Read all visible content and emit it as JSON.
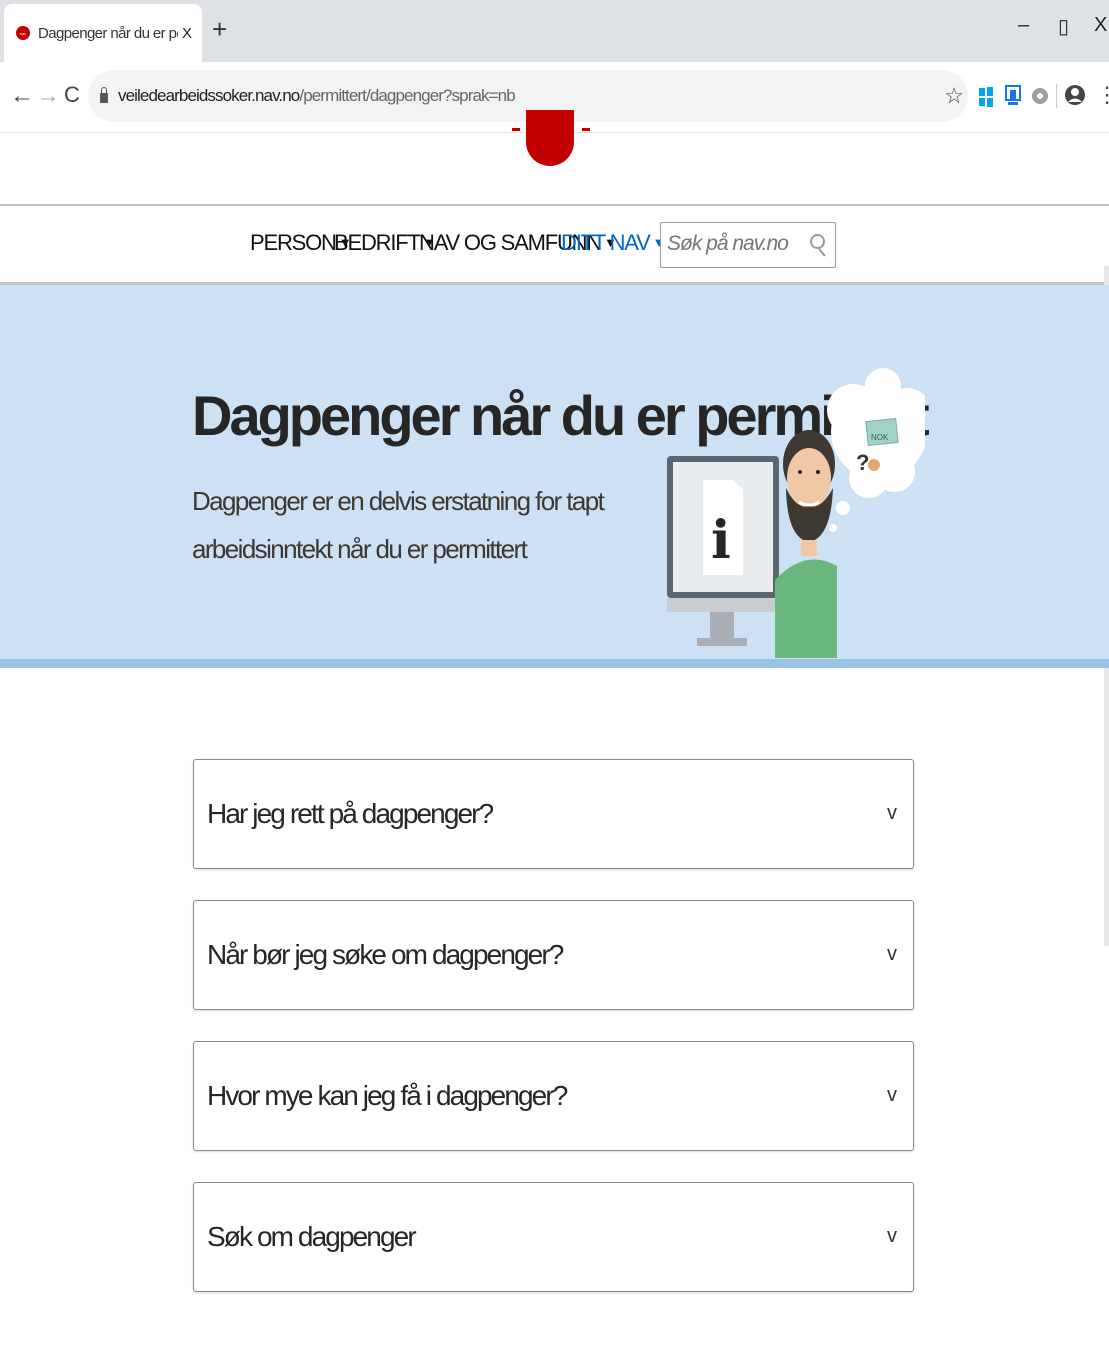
{
  "browser": {
    "tab_title": "Dagpenger når du er permittert - NAV",
    "tab_close": "X",
    "new_tab": "+",
    "window_minimize": "–",
    "window_restore": "▯",
    "window_close": "X",
    "back": "←",
    "forward": "→",
    "reload": "C",
    "url_domain": "veiledearbeidssoker.nav.no",
    "url_path": "/permittert/dagpenger?sprak=nb",
    "bookmark_star": "☆",
    "menu": "⋮"
  },
  "nav": {
    "items": [
      {
        "label": "PERSON",
        "caret": "▼"
      },
      {
        "label": "BEDRIFT",
        "caret": "▼"
      },
      {
        "label": "NAV OG SAMFUNN",
        "caret": "▼"
      },
      {
        "label": "DITT NAV",
        "caret": "▼"
      }
    ],
    "search_placeholder": "Søk på nav.no"
  },
  "hero": {
    "title": "Dagpenger når du er permittert",
    "lead": "Dagpenger er en delvis erstatning for tapt arbeidsinntekt når du er permittert",
    "bubble_label": "NOK",
    "bubble_question": "?",
    "screen_icon": "i"
  },
  "accordions": [
    {
      "label": "Har jeg rett på dagpenger?",
      "chevron": "v"
    },
    {
      "label": "Når bør jeg søke om dagpenger?",
      "chevron": "v"
    },
    {
      "label": "Hvor mye kan jeg få i dagpenger?",
      "chevron": "v"
    },
    {
      "label": "Søk om dagpenger",
      "chevron": "v"
    }
  ],
  "colors": {
    "nav_red": "#c30000",
    "hero_bg": "#cce1f3",
    "hero_border": "#99c2e8",
    "link_blue": "#0067c5",
    "person_shirt": "#6ab77e"
  }
}
